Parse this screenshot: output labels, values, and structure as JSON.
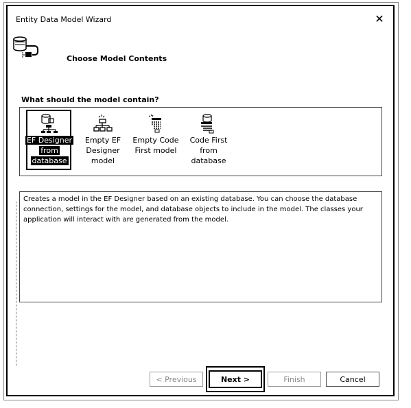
{
  "window": {
    "title": "Entity Data Model Wizard",
    "close_glyph": "✕"
  },
  "header": {
    "title": "Choose Model Contents",
    "icon": "database-wizard-icon"
  },
  "question": "What should the model contain?",
  "choices": [
    {
      "label_lines": [
        "EF Designer",
        "from",
        "database"
      ],
      "icon": "ef-designer-from-database-icon",
      "selected": true
    },
    {
      "label_lines": [
        "Empty EF",
        "Designer",
        "model"
      ],
      "icon": "empty-ef-designer-icon",
      "selected": false
    },
    {
      "label_lines": [
        "Empty Code",
        "First model"
      ],
      "icon": "empty-code-first-icon",
      "selected": false
    },
    {
      "label_lines": [
        "Code First",
        "from",
        "database"
      ],
      "icon": "code-first-from-database-icon",
      "selected": false
    }
  ],
  "description": "Creates a model in the EF Designer based on an existing database. You can choose the database connection, settings for the model, and database objects to include in the model. The classes your application will interact with are generated from the model.",
  "buttons": {
    "previous": "< Previous",
    "next": "Next >",
    "finish": "Finish",
    "cancel": "Cancel"
  }
}
